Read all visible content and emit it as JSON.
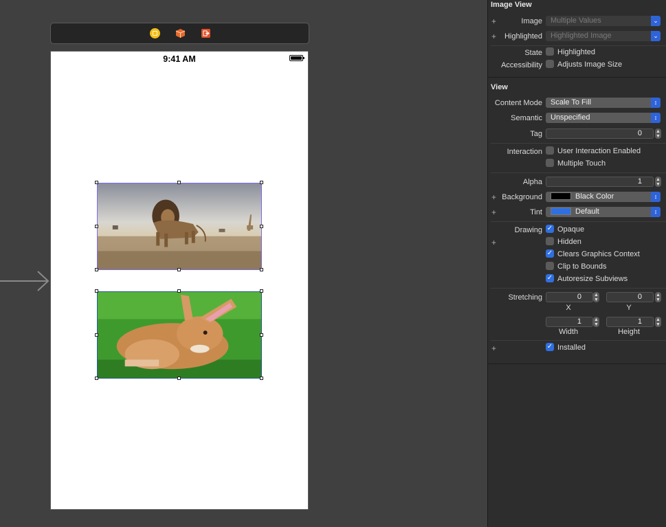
{
  "status_bar": {
    "time": "9:41 AM"
  },
  "scene_dock": {
    "icons": [
      "view-controller-icon",
      "first-responder-icon",
      "exit-icon"
    ]
  },
  "images": [
    {
      "name": "lion",
      "description_icon": "lion-photo"
    },
    {
      "name": "rabbit",
      "description_icon": "rabbit-photo"
    }
  ],
  "inspector": {
    "image_view": {
      "title": "Image View",
      "image_label": "Image",
      "image_value": "Multiple Values",
      "highlighted_label": "Highlighted",
      "highlighted_value": "Highlighted Image",
      "state_label": "State",
      "state_option": "Highlighted",
      "accessibility_label": "Accessibility",
      "accessibility_option": "Adjusts Image Size"
    },
    "view": {
      "title": "View",
      "content_mode_label": "Content Mode",
      "content_mode_value": "Scale To Fill",
      "semantic_label": "Semantic",
      "semantic_value": "Unspecified",
      "tag_label": "Tag",
      "tag_value": "0",
      "interaction_label": "Interaction",
      "user_interaction": "User Interaction Enabled",
      "multiple_touch": "Multiple Touch",
      "alpha_label": "Alpha",
      "alpha_value": "1",
      "background_label": "Background",
      "background_value": "Black Color",
      "background_color": "#000000",
      "tint_label": "Tint",
      "tint_value": "Default",
      "tint_color": "#2f6fe0",
      "drawing_label": "Drawing",
      "opaque": "Opaque",
      "hidden": "Hidden",
      "clears_graphics": "Clears Graphics Context",
      "clip_to_bounds": "Clip to Bounds",
      "autoresize": "Autoresize Subviews",
      "stretching_label": "Stretching",
      "stretch_x": "0",
      "stretch_y": "0",
      "stretch_x_label": "X",
      "stretch_y_label": "Y",
      "stretch_width": "1",
      "stretch_height": "1",
      "stretch_width_label": "Width",
      "stretch_height_label": "Height",
      "installed": "Installed"
    },
    "checked": {
      "highlighted": false,
      "adjusts_image_size": false,
      "user_interaction": false,
      "multiple_touch": false,
      "opaque": true,
      "hidden": false,
      "clears_graphics": true,
      "clip_to_bounds": false,
      "autoresize": true,
      "installed": true
    }
  }
}
